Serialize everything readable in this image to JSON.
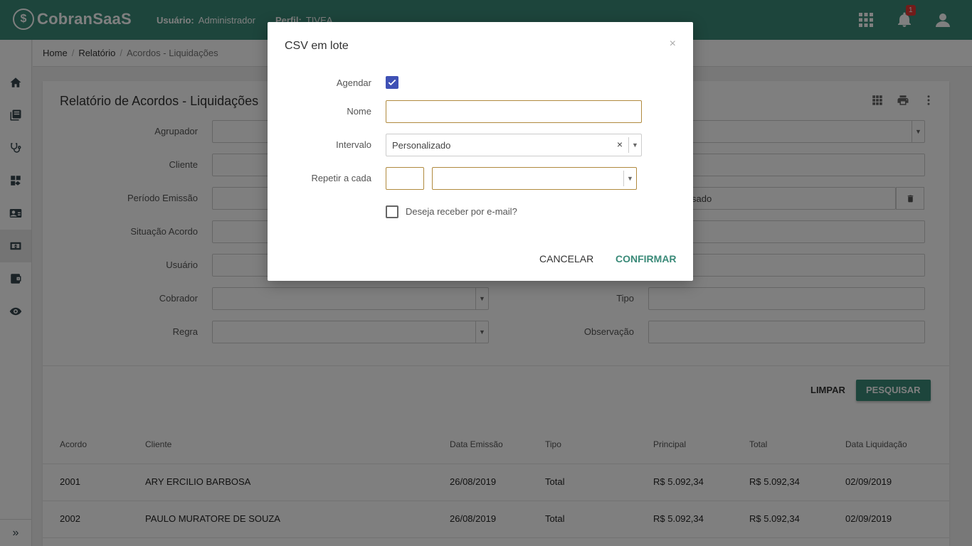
{
  "app": {
    "logo_mark": "$",
    "logo": "CobranSaaS"
  },
  "header": {
    "user_label": "Usuário:",
    "user_value": "Administrador",
    "perfil_label": "Perfil:",
    "perfil_value": "TIVEA",
    "notification_count": "1"
  },
  "sidebar": {
    "expand_label": "»"
  },
  "breadcrumb": [
    "Home",
    "Relatório",
    "Acordos - Liquidações"
  ],
  "page": {
    "title": "Relatório de Acordos - Liquidações",
    "filters_left": [
      "Agrupador",
      "Cliente",
      "Período Emissão",
      "Situação Acordo",
      "Usuário",
      "Cobrador",
      "Regra"
    ],
    "filters_right": [
      "Tipo",
      "Observação"
    ],
    "partial_value": "sado",
    "btn_clear": "LIMPAR",
    "btn_search": "PESQUISAR"
  },
  "table": {
    "headers": [
      "Acordo",
      "Cliente",
      "Data Emissão",
      "Tipo",
      "Principal",
      "Total",
      "Data Liquidação"
    ],
    "rows": [
      [
        "2001",
        "ARY ERCILIO BARBOSA",
        "26/08/2019",
        "Total",
        "R$ 5.092,34",
        "R$ 5.092,34",
        "02/09/2019"
      ],
      [
        "2002",
        "PAULO MURATORE DE SOUZA",
        "26/08/2019",
        "Total",
        "R$ 5.092,34",
        "R$ 5.092,34",
        "02/09/2019"
      ]
    ]
  },
  "modal": {
    "title": "CSV em lote",
    "close": "×",
    "agendar_label": "Agendar",
    "agendar_checked": true,
    "nome_label": "Nome",
    "nome_value": "",
    "intervalo_label": "Intervalo",
    "intervalo_value": "Personalizado",
    "repetir_label": "Repetir a cada",
    "repetir_value": "",
    "repetir_unit": "",
    "email_label": "Deseja receber por e-mail?",
    "email_checked": false,
    "cancel": "CANCELAR",
    "confirm": "CONFIRMAR"
  },
  "colors": {
    "primary": "#3a8a78",
    "checkbox": "#3f51b5",
    "badge": "#e53935"
  }
}
